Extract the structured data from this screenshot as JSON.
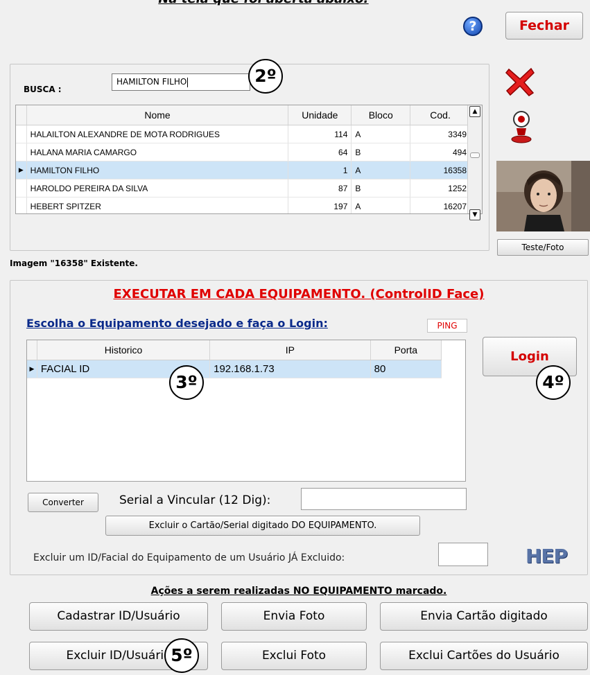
{
  "top_caption": "Na tela que foi aberta abaixo:",
  "header": {
    "close_label": "Fechar"
  },
  "busca": {
    "label": "BUSCA :",
    "value": "HAMILTON FILHO"
  },
  "people_table": {
    "columns": [
      "Nome",
      "Unidade",
      "Bloco",
      "Cod."
    ],
    "rows": [
      {
        "nome": "HALAILTON ALEXANDRE DE  MOTA RODRIGUES",
        "unidade": "114",
        "bloco": "A",
        "cod": "3349"
      },
      {
        "nome": "HALANA MARIA CAMARGO",
        "unidade": "64",
        "bloco": "B",
        "cod": "494"
      },
      {
        "nome": "HAMILTON FILHO",
        "unidade": "1",
        "bloco": "A",
        "cod": "16358"
      },
      {
        "nome": "HAROLDO PEREIRA DA SILVA",
        "unidade": "87",
        "bloco": "B",
        "cod": "1252"
      },
      {
        "nome": "HEBERT SPITZER",
        "unidade": "197",
        "bloco": "A",
        "cod": "16207"
      }
    ]
  },
  "photo": {
    "button_label": "Teste/Foto"
  },
  "status_text": "Imagem \"16358\" Existente.",
  "executar": {
    "title": "EXECUTAR EM CADA EQUIPAMENTO. (ControlID Face)",
    "subtitle": "Escolha o Equipamento desejado e faça o Login:",
    "ping_label": "PING",
    "login_label": "Login",
    "equip_table": {
      "columns": [
        "Historico",
        "IP",
        "Porta"
      ],
      "rows": [
        {
          "historico": "FACIAL ID",
          "ip": "192.168.1.73",
          "porta": "80"
        }
      ]
    },
    "converter_label": "Converter",
    "serial_label": "Serial a Vincular (12 Dig):",
    "serial_value": "",
    "excluir_cartao_label": "Excluir o Cartão/Serial digitado DO EQUIPAMENTO.",
    "excluir_id_label": "Excluir um ID/Facial do Equipamento de um Usuário JÁ Excluido:",
    "excluir_id_value": "",
    "logo_text": "HEP"
  },
  "acoes": {
    "title": "Ações a serem realizadas NO EQUIPAMENTO marcado.",
    "buttons": [
      "Cadastrar ID/Usuário",
      "Envia Foto",
      "Envia Cartão digitado",
      "Excluir ID/Usuário",
      "Exclui Foto",
      "Exclui Cartões do Usuário"
    ]
  },
  "step_badges": [
    "2º",
    "3º",
    "4º",
    "5º"
  ],
  "colors": {
    "accent_red": "#d40000",
    "link_blue": "#0a2a8a",
    "selection": "#cde4f7"
  }
}
